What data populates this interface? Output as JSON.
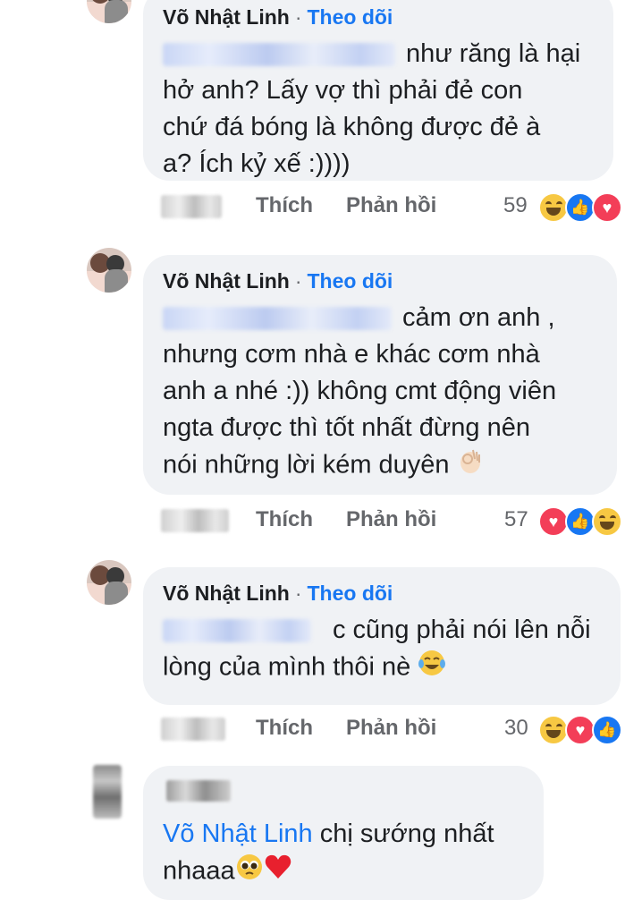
{
  "comments": [
    {
      "author": "Võ Nhật Linh",
      "separator": "·",
      "follow_label": "Theo dõi",
      "text_lines": [
        "như răng là hại",
        "hở anh? Lấy vợ thì phải đẻ con",
        "chứ đá bóng là không được đẻ à",
        "a? Ích kỷ xế :))))"
      ],
      "like_label": "Thích",
      "reply_label": "Phản hồi",
      "reaction_count": "59",
      "reactions": [
        "haha",
        "like",
        "love"
      ]
    },
    {
      "author": "Võ Nhật Linh",
      "separator": "·",
      "follow_label": "Theo dõi",
      "text_lines": [
        "cảm ơn anh ,",
        "nhưng cơm nhà e khác cơm nhà",
        "anh a nhé :)) không cmt động viên",
        "ngta được thì tốt nhất đừng nên",
        "nói những lời kém duyên"
      ],
      "end_emoji": "ok-hand",
      "like_label": "Thích",
      "reply_label": "Phản hồi",
      "reaction_count": "57",
      "reactions": [
        "love",
        "like",
        "haha"
      ]
    },
    {
      "author": "Võ Nhật Linh",
      "separator": "·",
      "follow_label": "Theo dõi",
      "text_lines": [
        "c cũng phải nói lên nỗi",
        "lòng của mình thôi nè"
      ],
      "end_emoji": "tears-of-joy",
      "like_label": "Thích",
      "reply_label": "Phản hồi",
      "reaction_count": "30",
      "reactions": [
        "haha",
        "love",
        "like"
      ]
    },
    {
      "mention": "Võ Nhật Linh",
      "text_lines": [
        "chị sướng nhất",
        "nhaaa"
      ],
      "end_emojis": [
        "pleading-face",
        "red-heart"
      ]
    }
  ],
  "colors": {
    "link": "#1877f2",
    "bubble": "#f0f2f5",
    "muted": "#65676b"
  }
}
